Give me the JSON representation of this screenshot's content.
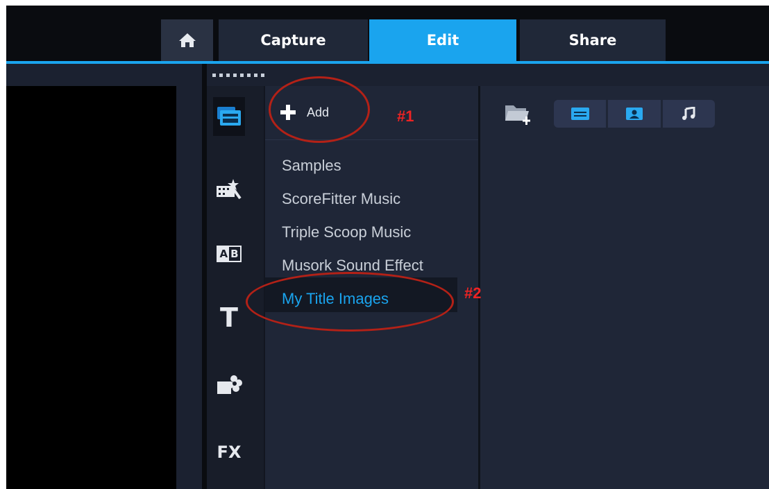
{
  "tabs": {
    "home_icon": "home-icon",
    "capture": "Capture",
    "edit": "Edit",
    "share": "Share",
    "active": "Edit",
    "accent_color": "#1aa4ee"
  },
  "rail": {
    "items": [
      {
        "icon": "media-library-icon",
        "active": true
      },
      {
        "icon": "instant-project-icon"
      },
      {
        "icon": "transition-icon"
      },
      {
        "icon": "title-icon"
      },
      {
        "icon": "graphics-icon"
      },
      {
        "icon": "filter-icon"
      }
    ],
    "title_glyph": "T",
    "transition_glyph_a": "A",
    "transition_glyph_b": "B",
    "fx_label": "FX"
  },
  "library": {
    "add_label": "Add",
    "items": [
      {
        "label": "Samples"
      },
      {
        "label": "ScoreFitter Music"
      },
      {
        "label": "Triple Scoop Music"
      },
      {
        "label": "Musork Sound Effect"
      },
      {
        "label": "My Title Images",
        "selected": true
      }
    ],
    "selected_color": "#1aa4ee"
  },
  "media": {
    "import_icon": "import-media-folder-icon",
    "filters": [
      {
        "icon": "show-videos-icon"
      },
      {
        "icon": "show-photos-icon"
      },
      {
        "icon": "show-audio-icon"
      }
    ]
  },
  "annotations": {
    "label_1": "#1",
    "label_2": "#2",
    "color": "#b32117"
  }
}
